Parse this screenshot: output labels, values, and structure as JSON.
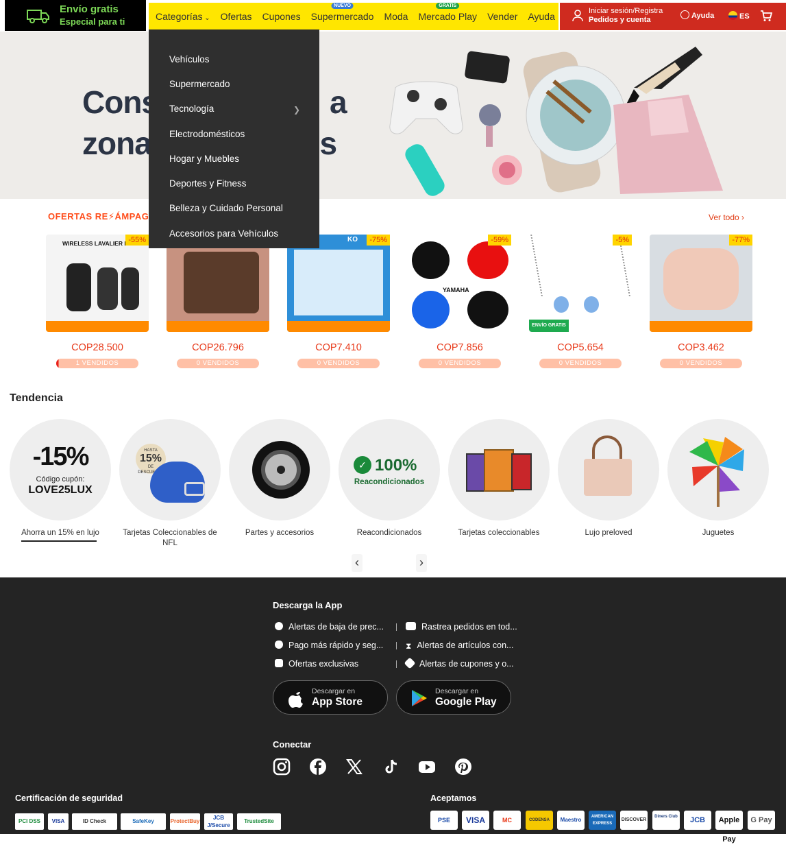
{
  "promo": {
    "line1": "Envío gratis",
    "line2": "Especial para ti",
    "icon": "truck-icon"
  },
  "nav": {
    "items": [
      {
        "label": "Categorías"
      },
      {
        "label": "Ofertas"
      },
      {
        "label": "Cupones"
      },
      {
        "label": "Supermercado",
        "badge": "NUEVO"
      },
      {
        "label": "Moda"
      },
      {
        "label": "Mercado Play",
        "badge": "GRATIS"
      },
      {
        "label": "Vender"
      },
      {
        "label": "Ayuda"
      }
    ]
  },
  "account": {
    "line1": "Iniciar sesión/Registra",
    "line2": "Pedidos y cuenta",
    "help": "Ayuda",
    "lang": "ES"
  },
  "hero": {
    "line1": "Cons",
    "line1_end": "a",
    "line2": "zona",
    "line2_end": "atis"
  },
  "dropdown": {
    "items": [
      "Vehículos",
      "Supermercado",
      "Tecnología",
      "Electrodomésticos",
      "Hogar y Muebles",
      "Deportes y Fitness",
      "Belleza y Cuidado Personal",
      "Accesorios para Vehículos"
    ]
  },
  "flash": {
    "title_a": "OFERTAS RE",
    "title_b": "ÁMPAGO",
    "see_all": "Ver todo",
    "products": [
      {
        "discount": "-55%",
        "price": "COP28.500",
        "sold": "1 VENDIDOS",
        "caption": "WIRELESS LAVALIER MIC",
        "sold_fraction": 0.03
      },
      {
        "discount": "",
        "price": "COP26.796",
        "sold": "0 VENDIDOS",
        "caption": "",
        "sold_fraction": 0
      },
      {
        "discount": "-75%",
        "price": "COP7.410",
        "sold": "0 VENDIDOS",
        "caption": "KO",
        "sold_fraction": 0
      },
      {
        "discount": "-59%",
        "price": "COP7.856",
        "sold": "0 VENDIDOS",
        "caption": "YAMAHA",
        "sold_fraction": 0
      },
      {
        "discount": "-5%",
        "price": "COP5.654",
        "sold": "0 VENDIDOS",
        "caption": "ENVÍO GRATIS",
        "sold_fraction": 0
      },
      {
        "discount": "-77%",
        "price": "COP3.462",
        "sold": "0 VENDIDOS",
        "caption": "",
        "sold_fraction": 0
      }
    ]
  },
  "trend": {
    "title": "Tendencia",
    "items": [
      {
        "label": "Ahorra un 15% en lujo",
        "big": "-15%",
        "sub1": "Código cupón:",
        "sub2": "LOVE25LUX"
      },
      {
        "label": "Tarjetas Coleccionables de NFL",
        "tag1": "HASTA",
        "tag2": "15%",
        "tag3": "DE DESCUENTO"
      },
      {
        "label": "Partes y accesorios"
      },
      {
        "label": "Reacondicionados",
        "big": "100%",
        "sub1": "Reacondicionados"
      },
      {
        "label": "Tarjetas coleccionables"
      },
      {
        "label": "Lujo preloved"
      },
      {
        "label": "Juguetes"
      }
    ]
  },
  "footer": {
    "app_title": "Descarga la App",
    "features": [
      "Alertas de baja de prec...",
      "Rastrea pedidos en tod...",
      "Pago más rápido y seg...",
      "Alertas de artículos con...",
      "Ofertas exclusivas",
      "Alertas de cupones y o..."
    ],
    "appstore": {
      "top": "Descargar en",
      "name": "App Store"
    },
    "googleplay": {
      "top": "Descargar en",
      "name": "Google Play"
    },
    "connect": "Conectar",
    "social": [
      "instagram-icon",
      "facebook-icon",
      "x-icon",
      "tiktok-icon",
      "youtube-icon",
      "pinterest-icon"
    ],
    "security_title": "Certificación de seguridad",
    "certs": [
      "PCI DSS",
      "VISA",
      "ID Check",
      "SafeKey",
      "ProtectBuy",
      "JCB J/Secure",
      "TrustedSite"
    ],
    "accept_title": "Aceptamos",
    "payments": [
      "PSE",
      "VISA",
      "MC",
      "CODENSA",
      "Maestro",
      "AMERICAN EXPRESS",
      "DISCOVER",
      "Diners Club",
      "JCB",
      "Apple Pay",
      "G Pay"
    ]
  },
  "colors": {
    "yellow": "#ffe600",
    "red": "#cf2b1f",
    "dark": "#242424",
    "flash": "#ff4c1a"
  }
}
